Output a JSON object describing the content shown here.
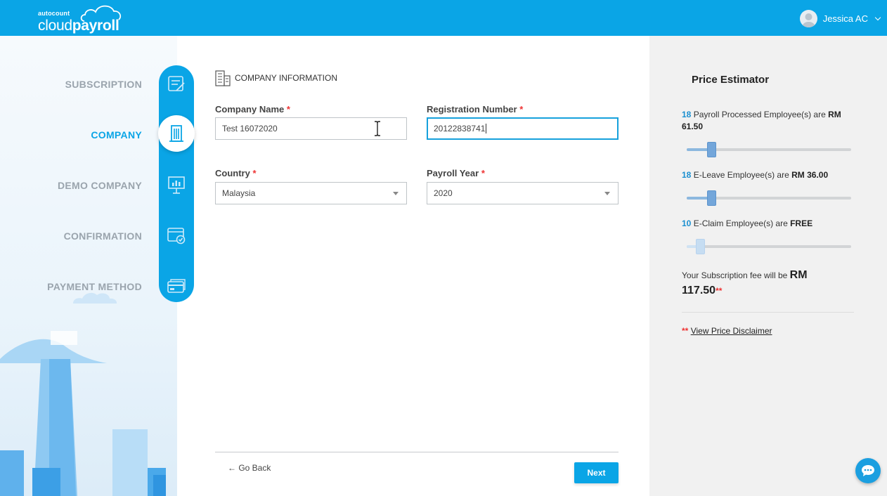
{
  "header": {
    "logo_small": "autocount",
    "logo_main_1": "cloud",
    "logo_main_2": "payroll",
    "user_name": "Jessica AC"
  },
  "steps": [
    {
      "label": "SUBSCRIPTION",
      "icon": "subscription-icon",
      "active": false
    },
    {
      "label": "COMPANY",
      "icon": "building-icon",
      "active": true
    },
    {
      "label": "DEMO COMPANY",
      "icon": "presentation-icon",
      "active": false
    },
    {
      "label": "CONFIRMATION",
      "icon": "confirmation-icon",
      "active": false
    },
    {
      "label": "PAYMENT METHOD",
      "icon": "credit-card-icon",
      "active": false
    }
  ],
  "form": {
    "section_title": "COMPANY INFORMATION",
    "company_name_label": "Company Name",
    "company_name_value": "Test 16072020",
    "registration_label": "Registration Number",
    "registration_value": "20122838741",
    "country_label": "Country",
    "country_value": "Malaysia",
    "payroll_year_label": "Payroll Year",
    "payroll_year_value": "2020",
    "required_mark": "*",
    "back_label": "← Go Back",
    "next_label": "Next"
  },
  "estimator": {
    "title": "Price Estimator",
    "payroll": {
      "count": "18",
      "text": "Payroll Processed Employee(s) are",
      "price": "RM 61.50",
      "level": 0.15
    },
    "eleave": {
      "count": "18",
      "text": "E-Leave Employee(s) are",
      "price": "RM 36.00",
      "level": 0.15
    },
    "eclaim": {
      "count": "10",
      "text": "E-Claim Employee(s) are",
      "price": "FREE",
      "level": 0.08
    },
    "fee_text": "Your Subscription fee will be",
    "fee_currency": "RM",
    "fee_amount": "117.50",
    "fee_mark": "**",
    "disclaimer_mark": "**",
    "disclaimer_link": "View Price Disclaimer"
  },
  "colors": {
    "brand": "#0aa5e6",
    "required": "#ee3333",
    "slider_thumb": "#73a6da"
  }
}
